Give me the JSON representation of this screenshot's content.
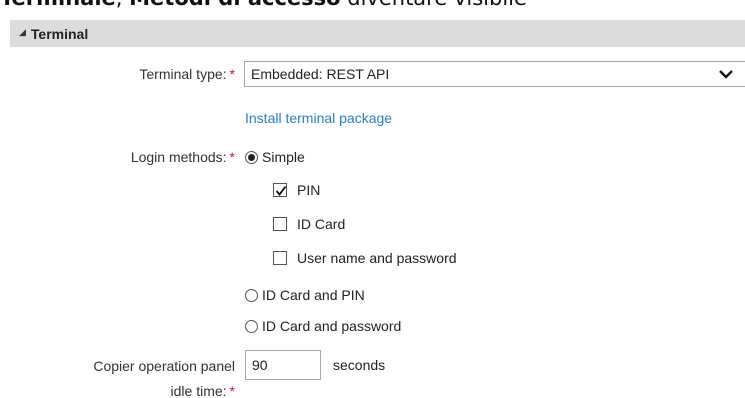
{
  "doc": {
    "bold_a": "Terminale",
    "sep": ", ",
    "bold_b": "Metodi di accesso",
    "rest": " diventare visibile"
  },
  "section": {
    "title": "Terminal"
  },
  "terminal_type": {
    "label": "Terminal type:",
    "required_mark": "*",
    "value": "Embedded: REST API"
  },
  "install_link": "Install terminal package",
  "login_methods": {
    "label": "Login methods:",
    "required_mark": "*",
    "options": [
      {
        "label": "Simple",
        "selected": true
      },
      {
        "label": "ID Card and PIN",
        "selected": false
      },
      {
        "label": "ID Card and password",
        "selected": false
      }
    ],
    "simple_sub": [
      {
        "label": "PIN",
        "checked": true
      },
      {
        "label": "ID Card",
        "checked": false
      },
      {
        "label": "User name and password",
        "checked": false
      }
    ]
  },
  "idle_time": {
    "label_line1": "Copier operation panel",
    "label_line2": "idle time:",
    "required_mark": "*",
    "value": "90",
    "unit": "seconds"
  }
}
